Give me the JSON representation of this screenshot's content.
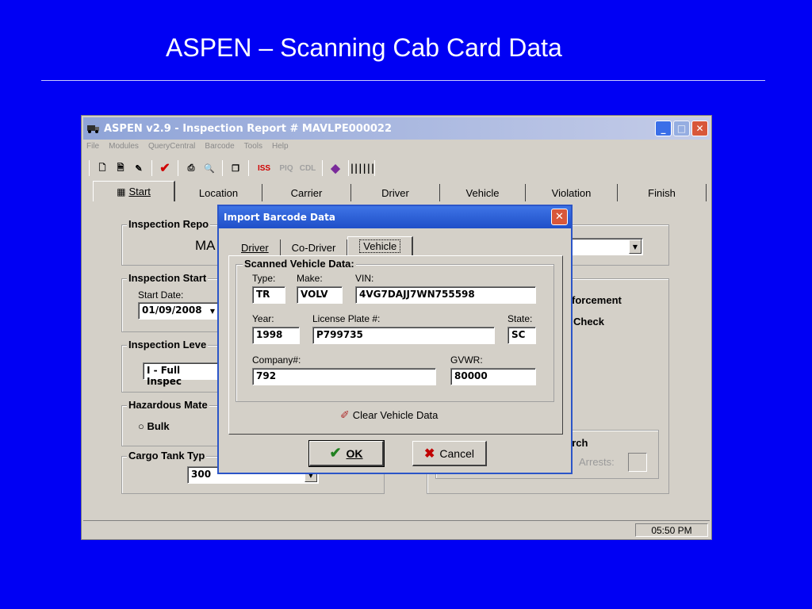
{
  "slide": {
    "title": "ASPEN – Scanning Cab Card Data"
  },
  "window": {
    "title": "ASPEN v2.9 - Inspection Report # MAVLPE000022",
    "menu": [
      "File",
      "Modules",
      "QueryCentral",
      "Barcode",
      "Tools",
      "Help"
    ],
    "toolbar": {
      "iss": "ISS",
      "pio": "PIQ",
      "cdl": "CDL"
    },
    "tabs": [
      "Start",
      "Location",
      "Carrier",
      "Driver",
      "Vehicle",
      "Violation",
      "Finish"
    ],
    "status_time": "05:50 PM"
  },
  "start": {
    "inspection_report_label": "Inspection Repo",
    "report_partial": "MA",
    "inspection_start_label": "Inspection Start",
    "start_date_label": "Start Date:",
    "start_date": "01/09/2008",
    "inspection_level_label": "Inspection Leve",
    "inspection_level": "I - Full Inspec",
    "hazmat_label": "Hazardous Mate",
    "bulk_label": "Bulk",
    "cargo_tank_label": "Cargo Tank Typ",
    "cargo_tank_value": "300",
    "enforcement_partial": "forcement",
    "check_partial": "Check",
    "search_partial": "arch",
    "arrests_label": "Arrests:"
  },
  "dialog": {
    "title": "Import Barcode Data",
    "tabs": [
      "Driver",
      "Co-Driver",
      "Vehicle"
    ],
    "group_label": "Scanned Vehicle Data:",
    "type_label": "Type:",
    "type_value": "TR",
    "make_label": "Make:",
    "make_value": "VOLV",
    "vin_label": "VIN:",
    "vin_value": "4VG7DAJJ7WN755598",
    "year_label": "Year:",
    "year_value": "1998",
    "plate_label": "License Plate #:",
    "plate_value": "P799735",
    "state_label": "State:",
    "state_value": "SC",
    "company_label": "Company#:",
    "company_value": "792",
    "gvwr_label": "GVWR:",
    "gvwr_value": "80000",
    "clear_label": "Clear Vehicle Data",
    "ok_label": "OK",
    "cancel_label": "Cancel"
  }
}
